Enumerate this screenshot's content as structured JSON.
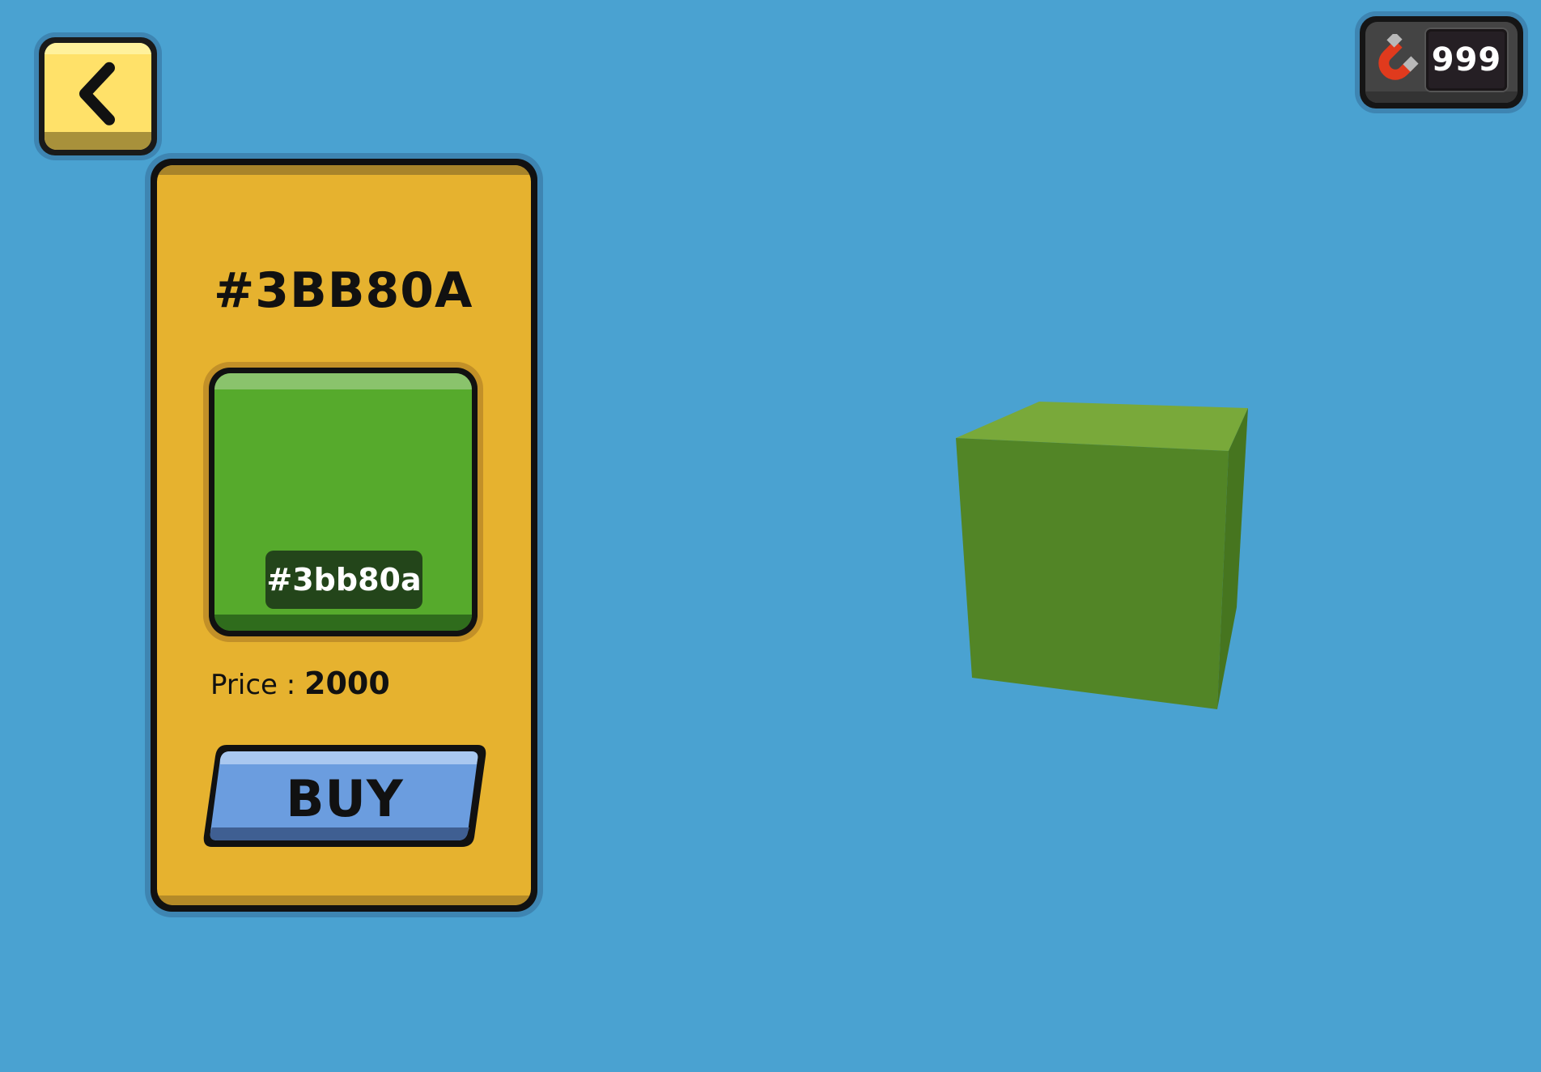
{
  "hud": {
    "back_icon": "chevron-left-icon",
    "currency_icon": "magnet-icon",
    "currency_count": "999"
  },
  "shop": {
    "title": "#3BB80A",
    "swatch_hex_label": "#3bb80a",
    "swatch_color": "#56aa2c",
    "price_label": "Price :",
    "price_value": "2000",
    "buy_label": "BUY"
  },
  "preview": {
    "object": "cube",
    "top_color": "#79a93a",
    "front_color": "#528526",
    "side_color": "#46751f"
  },
  "colors": {
    "background": "#4aa2d1",
    "card": "#e6b22f",
    "back_button": "#ffe169",
    "buy_button": "#6b9ddf"
  }
}
